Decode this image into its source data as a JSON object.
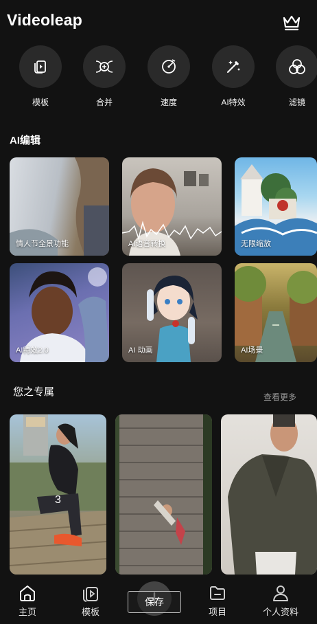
{
  "header": {
    "title": "Videoleap",
    "premium_icon": "crown-icon"
  },
  "tools": [
    {
      "label": "模板",
      "icon": "template-icon"
    },
    {
      "label": "合并",
      "icon": "merge-icon"
    },
    {
      "label": "速度",
      "icon": "speed-icon"
    },
    {
      "label": "AI特效",
      "icon": "magic-wand-icon"
    },
    {
      "label": "滤镜",
      "icon": "filter-icon"
    }
  ],
  "ai_section": {
    "title": "AI编辑",
    "cards": [
      {
        "caption": "情人节全景功能"
      },
      {
        "caption": "AI语音转换"
      },
      {
        "caption": "无限缩放"
      },
      {
        "caption": "AI特效2.0"
      },
      {
        "caption": "AI 动画"
      },
      {
        "caption": "AI场景"
      }
    ]
  },
  "for_you": {
    "title": "您之专属",
    "more": "查看更多",
    "counter": "3"
  },
  "bottom_nav": {
    "items": [
      {
        "label": "主页",
        "icon": "home-icon"
      },
      {
        "label": "模板",
        "icon": "template-icon"
      },
      {
        "label": "项目",
        "icon": "folder-icon"
      },
      {
        "label": "个人资料",
        "icon": "profile-icon"
      }
    ],
    "save_label": "保存"
  }
}
